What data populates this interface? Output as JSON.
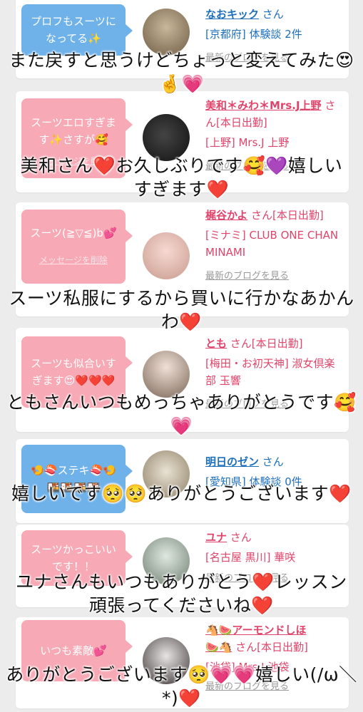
{
  "colors": {
    "card_bg": "#ffffff",
    "page_bg": "#ececec",
    "pink_bubble": "#f7a9b6",
    "blue_bubble": "#6fb2ea",
    "pink_text": "#e0446a",
    "blue_text": "#1d6fbd"
  },
  "delete_label": "メッセージを削除",
  "blog_label": "最新のブログを見る",
  "entries": [
    {
      "bubble_text": "プロフもスーツに\nなってる✨",
      "name": "なおキック",
      "honorific": "さん",
      "meta": "[京都府] 体験談 2件",
      "caption": "また戻すと思うけどちょっと変えてみた😍🤞💗"
    },
    {
      "bubble_text": "スーツエロすぎま\nす✨さすが🥰",
      "name": "美和＊みわ＊Mrs.J上野",
      "honorific": "さん[本日出勤]",
      "meta": "[上野] Mrs.J 上野",
      "caption": "美和さん❤️お久しぶりです🥰💜嬉しいすぎます❤️"
    },
    {
      "bubble_text": "スーツ(≧▽≦)b💕",
      "name": "梶谷かよ",
      "honorific": "さん[本日出勤]",
      "meta": "[ミナミ] CLUB ONE CHAN MINAMI",
      "caption": "スーツ私服にするから買いに行かなあかんわ❤️"
    },
    {
      "bubble_text": "スーツも似合いす\nぎます😍❤️❤️❤️",
      "name": "とも",
      "honorific": "さん[本日出勤]",
      "meta": "[梅田・お初天神] 淑女倶楽部 玉響",
      "caption": "ともさんいつもめっちゃありがとうです🥰💗"
    },
    {
      "bubble_text": "🍤🍣ステキ🍣🍤\n🍱🍱🍱🍱",
      "name": "明日のゼン",
      "honorific": "さん",
      "meta": "[愛知県] 体験談 0件",
      "caption": "嬉しいです🥺🥺ありがとうございます❤️"
    },
    {
      "bubble_text": "スーツかっこいい\nです！！",
      "name": "ユナ",
      "honorific": "さん",
      "meta": "[名古屋 黒川] 華咲",
      "caption": "ユナさんもいつもありがとう❤️レッスン頑張ってくださいね❤️"
    },
    {
      "bubble_text": "いつも素敵💕",
      "name": "🐴🍉アーモンドしほ",
      "name2": "🍉🐴",
      "honorific": "さん[本日出勤]",
      "meta": "[池袋] Mrs.J 池袋",
      "caption": "ありがとうございます🥺💗💗嬉しい(/ω＼*)❤️"
    }
  ]
}
